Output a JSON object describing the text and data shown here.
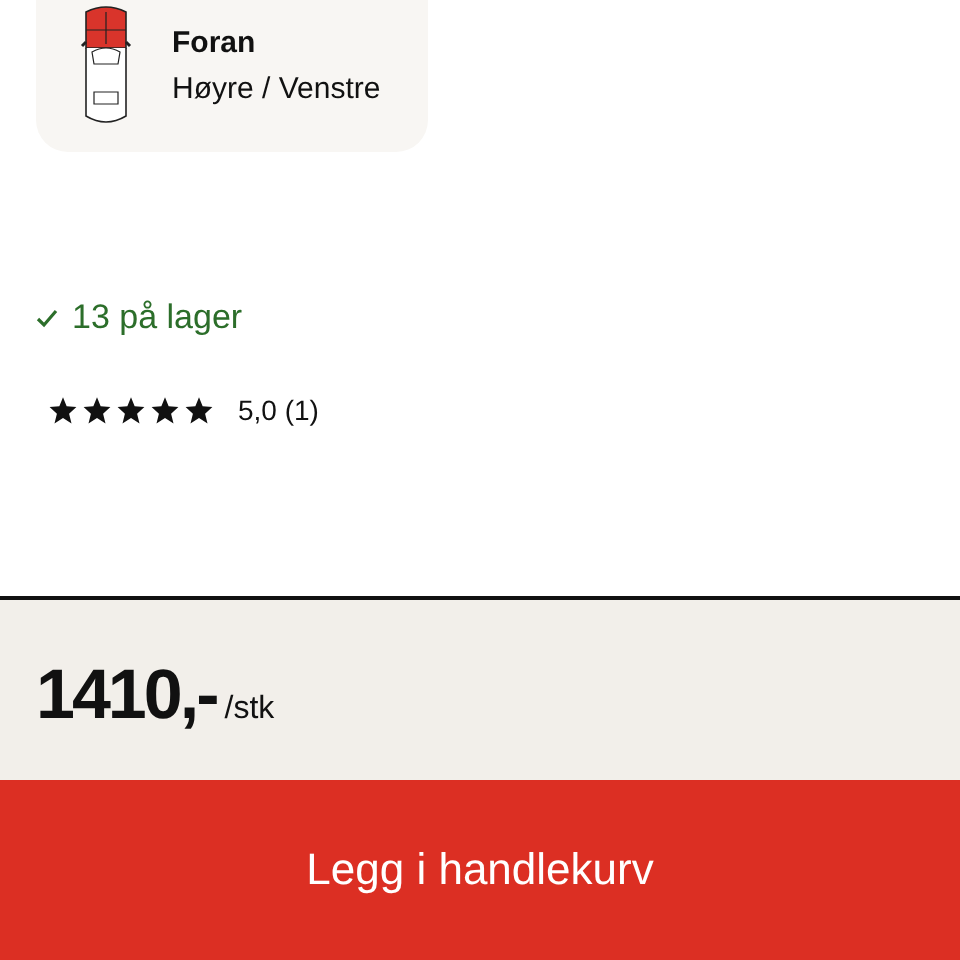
{
  "position_card": {
    "title": "Foran",
    "subtitle": "Høyre / Venstre"
  },
  "stock": {
    "in_stock": true,
    "text": "13 på lager"
  },
  "rating": {
    "stars": 5,
    "text": "5,0 (1)"
  },
  "price": {
    "amount": "1410,-",
    "unit": "/stk"
  },
  "cart_button": {
    "label": "Legg i handlekurv"
  }
}
